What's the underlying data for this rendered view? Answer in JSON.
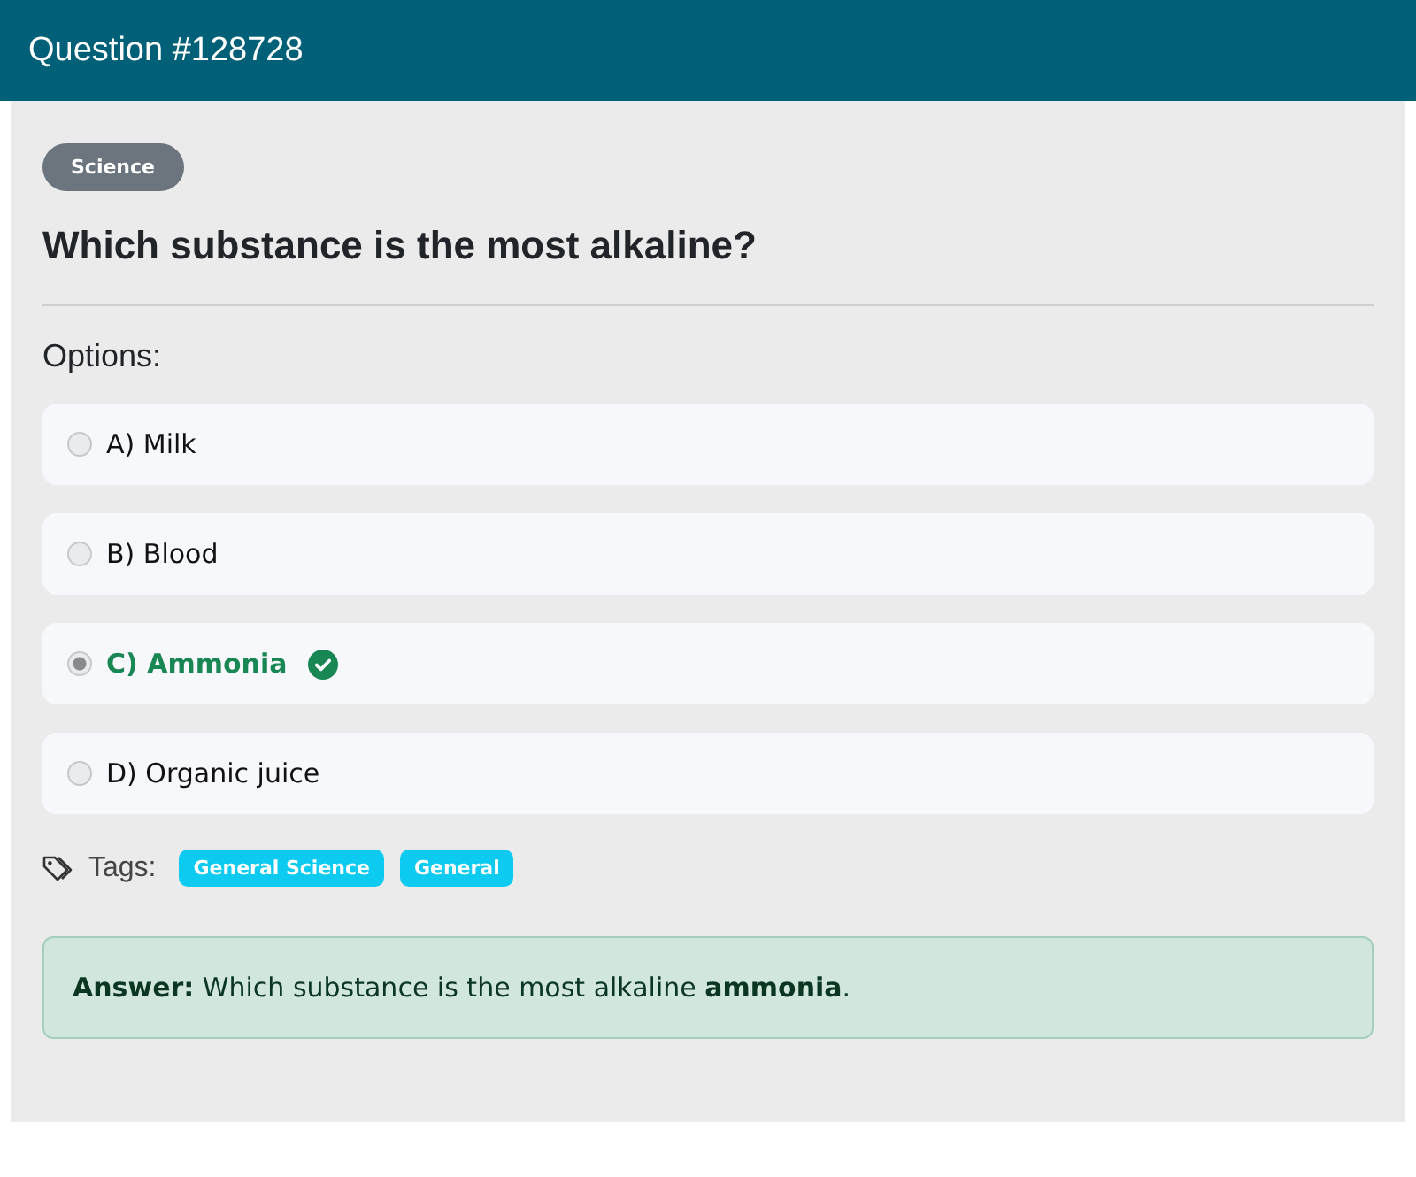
{
  "header": {
    "title": "Question #128728"
  },
  "category": "Science",
  "question": "Which substance is the most alkaline?",
  "options_heading": "Options:",
  "options": [
    {
      "label": "A) Milk",
      "selected": false,
      "correct": false
    },
    {
      "label": "B) Blood",
      "selected": false,
      "correct": false
    },
    {
      "label": "C) Ammonia",
      "selected": true,
      "correct": true
    },
    {
      "label": "D) Organic juice",
      "selected": false,
      "correct": false
    }
  ],
  "tags_label": "Tags:",
  "tags": [
    "General Science",
    "General"
  ],
  "answer": "**Answer:** Which substance is the most alkaline **ammonia**."
}
